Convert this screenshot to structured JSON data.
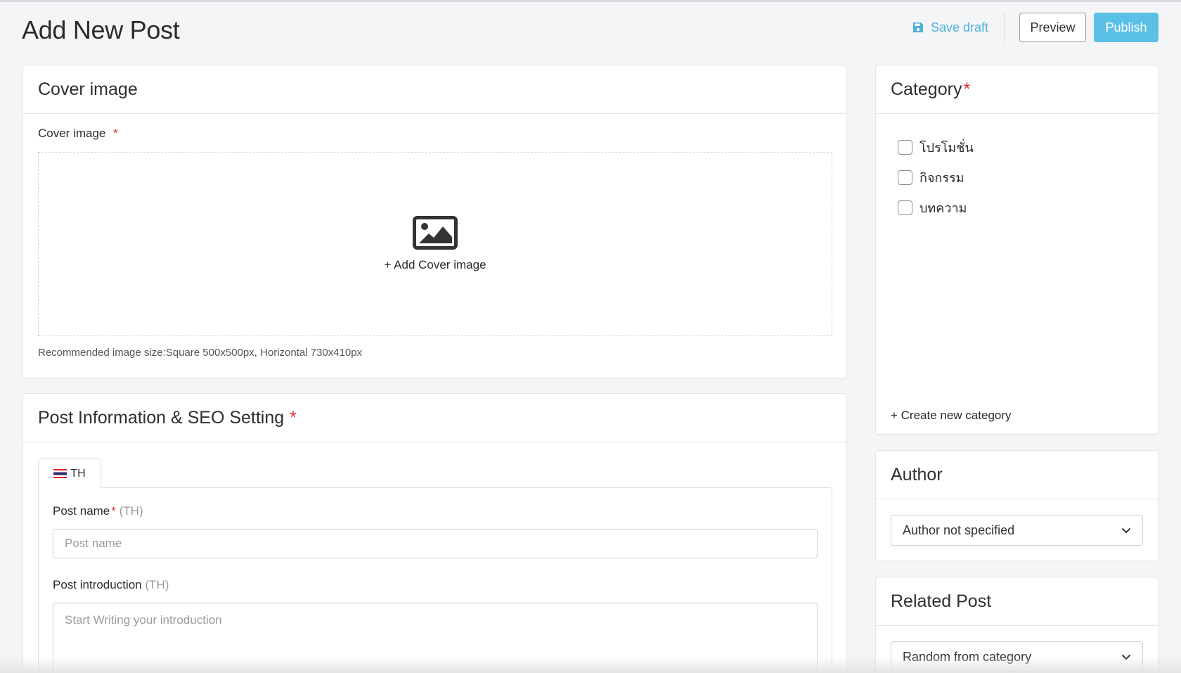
{
  "header": {
    "title": "Add New Post",
    "save_draft_label": "Save draft",
    "preview_label": "Preview",
    "publish_label": "Publish"
  },
  "cover": {
    "card_title": "Cover image",
    "field_label": "Cover image",
    "required_mark": "*",
    "add_label": "+ Add Cover image",
    "hint": "Recommended image size:Square 500x500px, Horizontal 730x410px"
  },
  "post_info": {
    "card_title": "Post Information & SEO Setting",
    "required_mark": "*",
    "tab_label": "TH",
    "post_name_label": "Post name",
    "post_name_lang": "(TH)",
    "post_name_placeholder": "Post name",
    "intro_label": "Post introduction",
    "intro_lang": "(TH)",
    "intro_placeholder": "Start Writing your introduction"
  },
  "category": {
    "title": "Category",
    "required_mark": "*",
    "items": [
      {
        "label": "โปรโมชั่น",
        "checked": false
      },
      {
        "label": "กิจกรรม",
        "checked": false
      },
      {
        "label": "บทความ",
        "checked": false
      }
    ],
    "create_label": "+ Create new category"
  },
  "author": {
    "title": "Author",
    "selected": "Author not specified"
  },
  "related": {
    "title": "Related Post",
    "selected": "Random from category"
  },
  "colors": {
    "accent": "#4ab1dd",
    "primary_button": "#5bc0e6",
    "required": "#e02d2d"
  }
}
